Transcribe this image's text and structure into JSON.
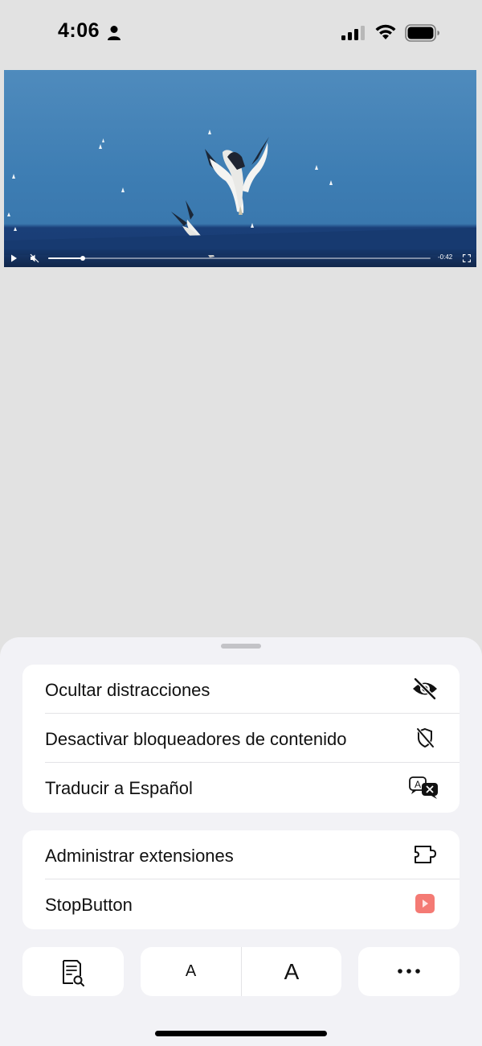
{
  "status_bar": {
    "time": "4:06",
    "icons": [
      "person-icon",
      "signal-icon",
      "wifi-icon",
      "battery-icon"
    ]
  },
  "video": {
    "remaining_time": "-0:42",
    "progress": 0.09,
    "icons": [
      "play-icon",
      "mute-icon",
      "fullscreen-icon"
    ]
  },
  "menu": {
    "group1": [
      {
        "label": "Ocultar distracciones",
        "icon": "eye-slash-icon"
      },
      {
        "label": "Desactivar bloqueadores de contenido",
        "icon": "shield-slash-icon"
      },
      {
        "label": "Traducir a Español",
        "icon": "translate-icon"
      }
    ],
    "group2": [
      {
        "label": "Administrar extensiones",
        "icon": "puzzle-icon"
      },
      {
        "label": "StopButton",
        "icon": "stopbutton-icon"
      }
    ]
  },
  "toolbar": {
    "reader_icon": "reader-icon",
    "font_smaller": "A",
    "font_larger": "A",
    "more_icon": "ellipsis-icon"
  },
  "colors": {
    "background": "#e2e2e2",
    "sheet": "#f2f2f6",
    "stopbutton_accent": "#f47a74"
  }
}
